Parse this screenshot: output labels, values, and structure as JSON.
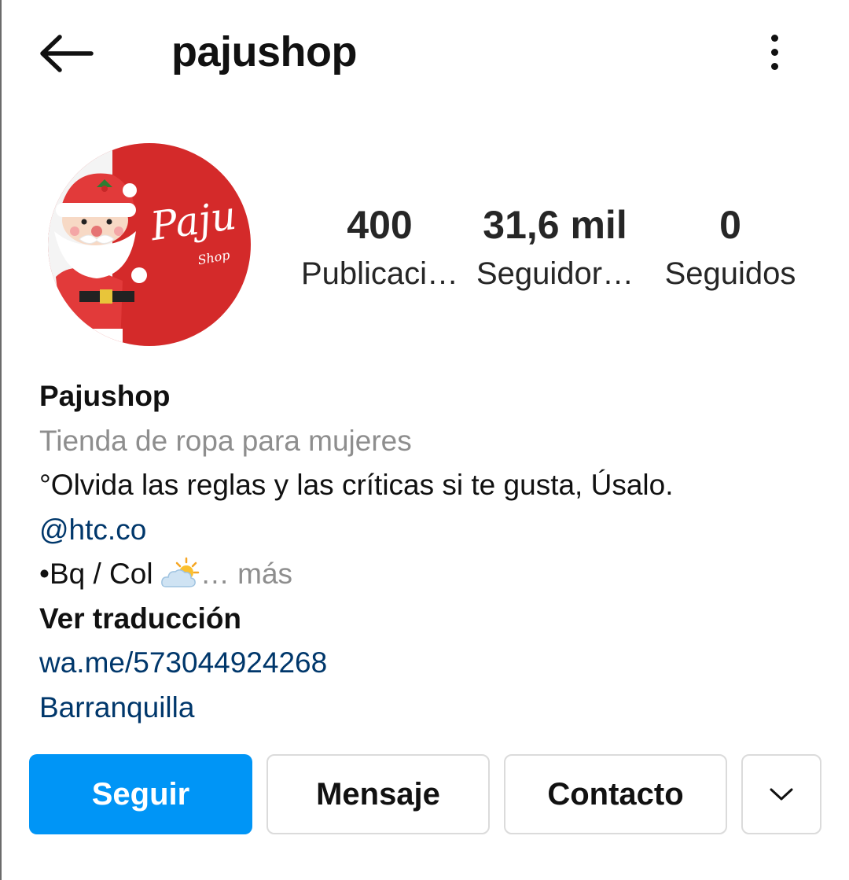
{
  "header": {
    "username": "pajushop",
    "back_icon": "arrow-left-icon",
    "menu_icon": "more-vertical-icon"
  },
  "avatar": {
    "logo_text": "Paju",
    "logo_subtext": "Shop",
    "bg_color": "#d42a2a"
  },
  "stats": {
    "posts": {
      "count": "400",
      "label": "Publicaci…"
    },
    "followers": {
      "count": "31,6 mil",
      "label": "Seguidor…"
    },
    "following": {
      "count": "0",
      "label": "Seguidos"
    }
  },
  "bio": {
    "name": "Pajushop",
    "category": "Tienda de ropa para mujeres",
    "line1": "°Olvida las reglas y las críticas si te gusta, Úsalo.",
    "mention": "@htc.co",
    "line3_text": "•Bq / Col ",
    "line3_emoji": "sun-behind-cloud-icon",
    "more_label": "… más",
    "translate_label": "Ver traducción",
    "website": "wa.me/573044924268",
    "location": "Barranquilla"
  },
  "actions": {
    "follow_label": "Seguir",
    "message_label": "Mensaje",
    "contact_label": "Contacto",
    "dropdown_icon": "chevron-down-icon"
  },
  "colors": {
    "accent": "#0095f6",
    "link": "#00376b",
    "muted": "#8e8e8e"
  }
}
